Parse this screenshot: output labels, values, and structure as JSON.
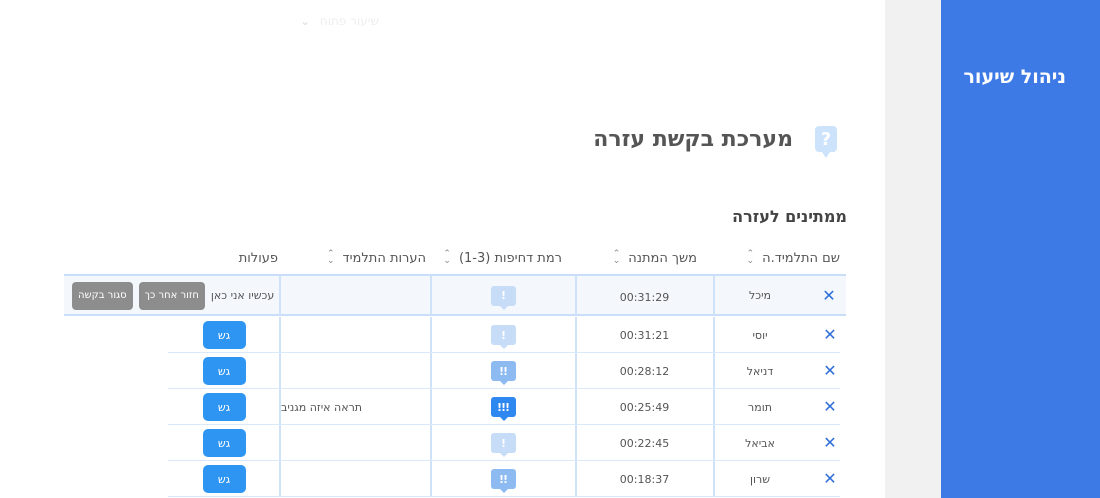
{
  "sidebar": {
    "title": "ניהול שיעור"
  },
  "top_select": {
    "value": "שיעור פתוח"
  },
  "page": {
    "title": "מערכת בקשת עזרה",
    "section_title": "ממתינים לעזרה"
  },
  "table": {
    "headers": {
      "name": "שם התלמיד.ה",
      "wait": "משך המתנה",
      "urgency": "(1-3) רמת דחיפות",
      "notes": "הערות התלמיד",
      "actions": "פעולות"
    },
    "first_row": {
      "name": "מיכל",
      "wait": "00:31:29",
      "urgency": 1,
      "urgency_glyph": "!",
      "notes": "",
      "here_text": "עכשיו אני כאן",
      "later_label": "חזור אחר כך",
      "close_label": "סגור בקשה"
    },
    "rows": [
      {
        "name": "יוסי",
        "wait": "00:31:21",
        "urgency": 1,
        "urgency_glyph": "!",
        "notes": "",
        "action": "גש"
      },
      {
        "name": "דניאל",
        "wait": "00:28:12",
        "urgency": 2,
        "urgency_glyph": "!!",
        "notes": "",
        "action": "גש"
      },
      {
        "name": "תומר",
        "wait": "00:25:49",
        "urgency": 3,
        "urgency_glyph": "!!!",
        "notes": "תראה איזה מגניב",
        "action": "גש"
      },
      {
        "name": "אביאל",
        "wait": "00:22:45",
        "urgency": 1,
        "urgency_glyph": "!",
        "notes": "",
        "action": "גש"
      },
      {
        "name": "שרון",
        "wait": "00:18:37",
        "urgency": 2,
        "urgency_glyph": "!!",
        "notes": "",
        "action": "גש"
      }
    ]
  },
  "colors": {
    "sidebar": "#3d7ae5",
    "accent_button": "#2e96f2",
    "close_icon": "#2e6fd8",
    "urgency_1": "#c6dcf7",
    "urgency_2": "#8dbaf1",
    "urgency_3": "#2e88f0"
  },
  "icons": {
    "help": "question-bubble-icon",
    "remove": "close-icon",
    "sort": "sort-arrows-icon",
    "select": "chevron-down-icon"
  }
}
